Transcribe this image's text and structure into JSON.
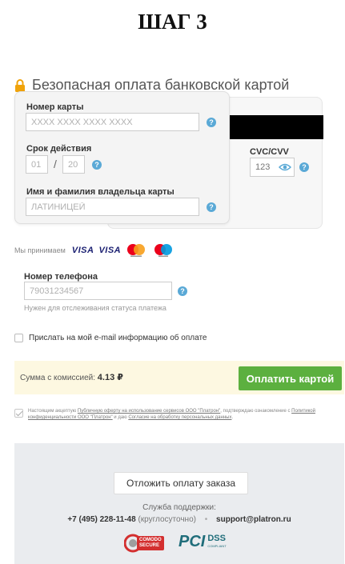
{
  "step_title": "ШАГ 3",
  "secure_title": "Безопасная оплата банковской картой",
  "card": {
    "number_label": "Номер карты",
    "number_placeholder": "XXXX XXXX XXXX XXXX",
    "expiry_label": "Срок действия",
    "expiry_month": "01",
    "expiry_year": "20",
    "holder_label": "Имя и фамилия владельца карты",
    "holder_placeholder": "ЛАТИНИЦЕЙ",
    "cvc_label": "CVC/CVV",
    "cvc_placeholder": "123"
  },
  "accept": {
    "text": "Мы принимаем",
    "visa1": "VISA",
    "visa2": "VISA"
  },
  "phone": {
    "label": "Номер телефона",
    "placeholder": "79031234567",
    "note": "Нужен для отслеживания статуса платежа"
  },
  "email_checkbox_label": "Прислать на мой e-mail информацию об оплате",
  "payment": {
    "sum_label": "Сумма с комиссией:",
    "sum_value": "4.13 ₽",
    "pay_button": "Оплатить картой"
  },
  "agreement": {
    "part1": "Настоящим акцептую ",
    "link1": "Публичную оферту на использование сервисов ООО \"Платрон\"",
    "part2": ", подтверждаю ознакомление с ",
    "link2": "Политикой конфиденциальности ООО \"Платрон\"",
    "part3": " и даю ",
    "link3": "Согласие на обработку персональных данных",
    "part4": "."
  },
  "footer": {
    "postpone_button": "Отложить оплату заказа",
    "support_label": "Служба поддержки:",
    "support_phone": "+7 (495) 228-11-48",
    "support_hours": "(круглосуточно)",
    "support_email": "support@platron.ru",
    "comodo_line1": "COMODO",
    "comodo_line2": "SECURE",
    "pci_text": "PCI",
    "dss_text": "DSS",
    "dss_sub": "COMPLIANT"
  },
  "colors": {
    "accent_green": "#5cb03f",
    "help_blue": "#5aa9d6",
    "lock_orange": "#f0a30a",
    "pay_bar_bg": "#fdf8e1"
  },
  "icons": [
    "lock-icon",
    "help-icon",
    "eye-icon",
    "mastercard-icon",
    "maestro-icon",
    "comodo-icon"
  ]
}
